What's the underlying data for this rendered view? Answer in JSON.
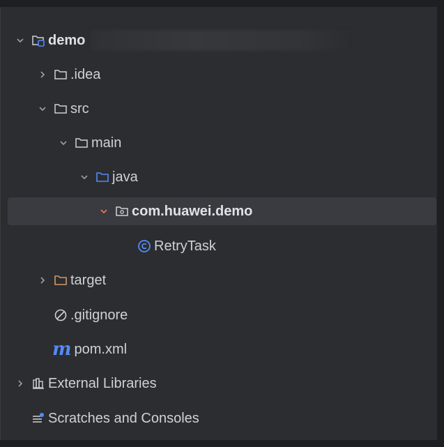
{
  "project_tree": {
    "root": {
      "label": "demo"
    },
    "items": [
      {
        "label": ".idea"
      },
      {
        "label": "src"
      },
      {
        "label": "main"
      },
      {
        "label": "java"
      },
      {
        "label": "com.huawei.demo"
      },
      {
        "label": "RetryTask"
      },
      {
        "label": "target"
      },
      {
        "label": ".gitignore"
      },
      {
        "label": "pom.xml"
      }
    ],
    "external_libraries": "External Libraries",
    "scratches": "Scratches and Consoles"
  },
  "icons": {
    "chevron_collapsed": "chevron-right-icon",
    "chevron_expanded": "chevron-down-icon",
    "folder": "folder-icon",
    "module": "module-folder-icon",
    "source_root": "source-root-folder-icon",
    "package": "package-icon",
    "class": "class-icon",
    "excluded": "excluded-folder-icon",
    "ignore": "gitignore-icon",
    "maven": "maven-icon",
    "library": "library-icon",
    "scratch": "scratch-icon"
  },
  "colors": {
    "background": "#2b2d30",
    "selection": "#393b40",
    "text": "#cfd1d6",
    "source_blue": "#548af7",
    "excluded_orange": "#d19a66",
    "package_chevron": "#e8764b"
  }
}
